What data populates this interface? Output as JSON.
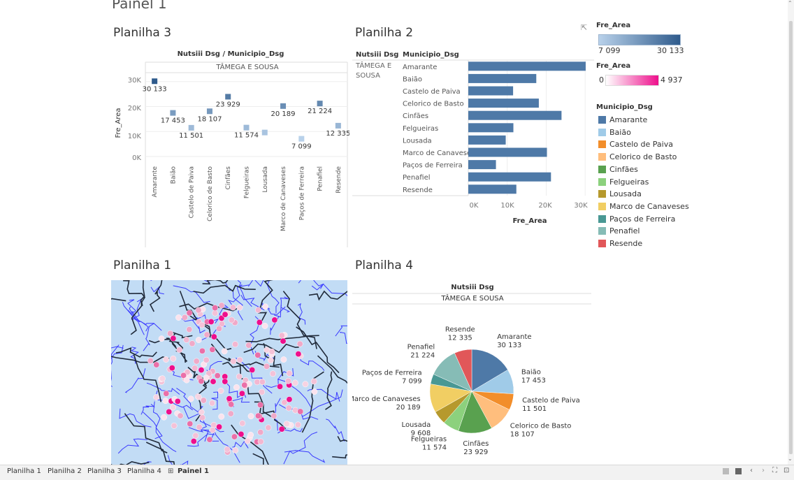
{
  "dashboard": {
    "title": "Painel 1"
  },
  "sheet3": {
    "title": "Planilha 3",
    "header": "Nutsiii Dsg / Municipio_Dsg",
    "group": "TÂMEGA E SOUSA",
    "ylabel": "Fre_Area",
    "yticks": [
      "30K",
      "20K",
      "10K",
      "0K"
    ]
  },
  "sheet2": {
    "title": "Planilha 2",
    "col1": "Nutsiii Dsg",
    "col2": "Municipio_Dsg",
    "group_line1": "TÂMEGA E",
    "group_line2": "SOUSA",
    "xlabel": "Fre_Area",
    "xticks": [
      "0K",
      "10K",
      "20K",
      "30K"
    ]
  },
  "sheet1": {
    "title": "Planilha 1"
  },
  "sheet4": {
    "title": "Planilha 4",
    "header": "Nutsiii Dsg",
    "group": "TÂMEGA E SOUSA"
  },
  "legends": {
    "area_title": "Fre_Area",
    "area_min": "7 099",
    "area_max": "30 133",
    "area_color_low": "#b8d1ea",
    "area_color_high": "#2f5b8c",
    "pink_title": "Fre_Area",
    "pink_min": "0",
    "pink_max": "4 937",
    "pink_color_low": "#ffffff",
    "pink_color_high": "#ee0f8c",
    "mun_title": "Municipio_Dsg"
  },
  "chart_data": [
    {
      "type": "scatter",
      "name": "Planilha 3",
      "categories": [
        "Amarante",
        "Baião",
        "Castelo de Paiva",
        "Celorico de Basto",
        "Cinfães",
        "Felgueiras",
        "Lousada",
        "Marco de Canaveses",
        "Paços de Ferreira",
        "Penafiel",
        "Resende"
      ],
      "values": [
        30133,
        17453,
        11501,
        18107,
        23929,
        11574,
        9608,
        20189,
        7099,
        21224,
        12335
      ],
      "labels": [
        "30 133",
        "17 453",
        "11 501",
        "18 107",
        "23 929",
        "11 574",
        "",
        "20 189",
        "7 099",
        "21 224",
        "12 335"
      ],
      "ylim": [
        0,
        33000
      ],
      "ylabel": "Fre_Area"
    },
    {
      "type": "bar",
      "name": "Planilha 2",
      "orientation": "horizontal",
      "categories": [
        "Amarante",
        "Baião",
        "Castelo de Paiva",
        "Celorico de Basto",
        "Cinfães",
        "Felgueiras",
        "Lousada",
        "Marco de Canaveses",
        "Paços de Ferreira",
        "Penafiel",
        "Resende"
      ],
      "values": [
        30133,
        17453,
        11501,
        18107,
        23929,
        11574,
        9608,
        20189,
        7099,
        21224,
        12335
      ],
      "xlim": [
        0,
        30500
      ],
      "xlabel": "Fre_Area",
      "color": "#4e79a7"
    },
    {
      "type": "pie",
      "name": "Planilha 4",
      "categories": [
        "Amarante",
        "Baião",
        "Castelo de Paiva",
        "Celorico de Basto",
        "Cinfães",
        "Felgueiras",
        "Lousada",
        "Marco de Canaveses",
        "Paços de Ferreira",
        "Penafiel",
        "Resende"
      ],
      "values": [
        30133,
        17453,
        11501,
        18107,
        23929,
        11574,
        9608,
        20189,
        7099,
        21224,
        12335
      ],
      "labels": [
        "30 133",
        "17 453",
        "11 501",
        "18 107",
        "23 929",
        "11 574",
        "9 608",
        "20 189",
        "7 099",
        "21 224",
        "12 335"
      ],
      "colors": [
        "#4e79a7",
        "#a0cbe8",
        "#f28e2b",
        "#ffbe7d",
        "#59a14f",
        "#8cd17d",
        "#b6992d",
        "#f1ce63",
        "#499894",
        "#86bcb6",
        "#e15759"
      ]
    }
  ],
  "tabs": [
    "Planilha 1",
    "Planilha 2",
    "Planilha 3",
    "Planilha 4",
    "Painel 1"
  ]
}
